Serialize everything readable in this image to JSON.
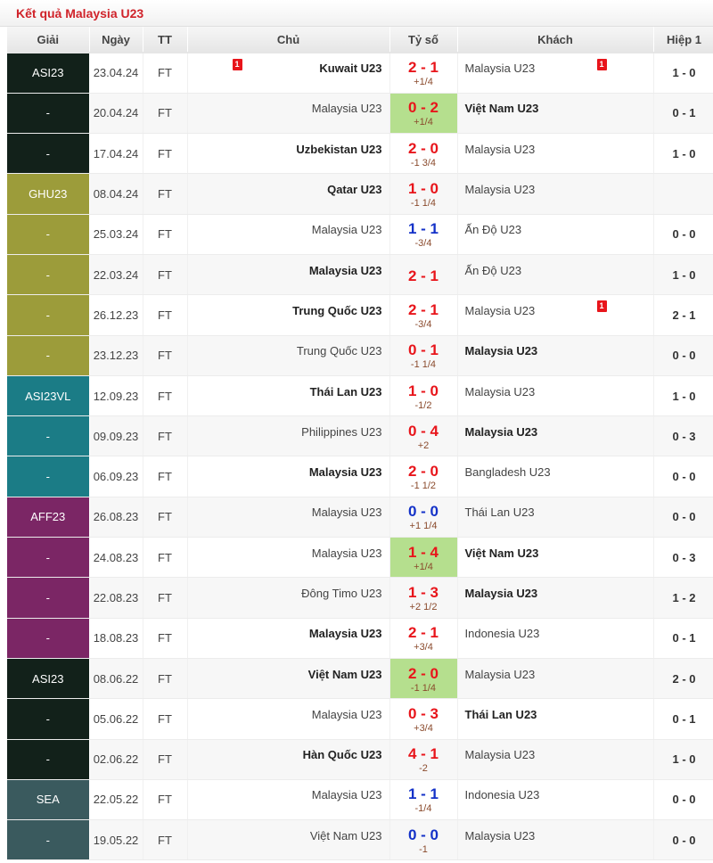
{
  "page": {
    "title": "Kết quả Malaysia U23"
  },
  "columns": {
    "league": "Giải",
    "date": "Ngày",
    "status": "TT",
    "home": "Chủ",
    "score": "Tỷ số",
    "away": "Khách",
    "halftime": "Hiệp 1"
  },
  "colors": {
    "title": "#d0232a",
    "score_red": "#e8151b",
    "score_blue": "#1432c8",
    "handicap": "#8a4a2c",
    "highlight_score": "#b5df8e",
    "card": "#e8151b",
    "league_ASI23": "#12211a",
    "league_GHU23": "#9c9c3a",
    "league_ASI23VL": "#1b7c86",
    "league_AFF23": "#7b2665",
    "league_SEA": "#3a5a5e"
  },
  "matches": [
    {
      "league": "ASI23",
      "date": "23.04.24",
      "status": "FT",
      "home": "Kuwait U23",
      "home_bold": true,
      "home_card": "1",
      "score": "2 - 1",
      "score_color": "red",
      "handicap": "+1/4",
      "score_highlight": false,
      "away": "Malaysia U23",
      "away_bold": false,
      "away_card": "1",
      "ht": "1 - 0",
      "league_color": "#12211a"
    },
    {
      "league": "-",
      "date": "20.04.24",
      "status": "FT",
      "home": "Malaysia U23",
      "home_bold": false,
      "home_card": "",
      "score": "0 - 2",
      "score_color": "red",
      "handicap": "+1/4",
      "score_highlight": true,
      "away": "Việt Nam U23",
      "away_bold": true,
      "away_card": "",
      "ht": "0 - 1",
      "league_color": "#12211a"
    },
    {
      "league": "-",
      "date": "17.04.24",
      "status": "FT",
      "home": "Uzbekistan U23",
      "home_bold": true,
      "home_card": "",
      "score": "2 - 0",
      "score_color": "red",
      "handicap": "-1 3/4",
      "score_highlight": false,
      "away": "Malaysia U23",
      "away_bold": false,
      "away_card": "",
      "ht": "1 - 0",
      "league_color": "#12211a"
    },
    {
      "league": "GHU23",
      "date": "08.04.24",
      "status": "FT",
      "home": "Qatar U23",
      "home_bold": true,
      "home_card": "",
      "score": "1 - 0",
      "score_color": "red",
      "handicap": "-1 1/4",
      "score_highlight": false,
      "away": "Malaysia U23",
      "away_bold": false,
      "away_card": "",
      "ht": "",
      "league_color": "#9c9c3a"
    },
    {
      "league": "-",
      "date": "25.03.24",
      "status": "FT",
      "home": "Malaysia U23",
      "home_bold": false,
      "home_card": "",
      "score": "1 - 1",
      "score_color": "blue",
      "handicap": "-3/4",
      "score_highlight": false,
      "away": "Ấn Độ U23",
      "away_bold": false,
      "away_card": "",
      "ht": "0 - 0",
      "league_color": "#9c9c3a"
    },
    {
      "league": "-",
      "date": "22.03.24",
      "status": "FT",
      "home": "Malaysia U23",
      "home_bold": true,
      "home_card": "",
      "score": "2 - 1",
      "score_color": "red",
      "handicap": "",
      "score_highlight": false,
      "away": "Ấn Độ U23",
      "away_bold": false,
      "away_card": "",
      "ht": "1 - 0",
      "league_color": "#9c9c3a"
    },
    {
      "league": "-",
      "date": "26.12.23",
      "status": "FT",
      "home": "Trung Quốc U23",
      "home_bold": true,
      "home_card": "",
      "score": "2 - 1",
      "score_color": "red",
      "handicap": "-3/4",
      "score_highlight": false,
      "away": "Malaysia U23",
      "away_bold": false,
      "away_card": "1",
      "ht": "2 - 1",
      "league_color": "#9c9c3a"
    },
    {
      "league": "-",
      "date": "23.12.23",
      "status": "FT",
      "home": "Trung Quốc U23",
      "home_bold": false,
      "home_card": "",
      "score": "0 - 1",
      "score_color": "red",
      "handicap": "-1 1/4",
      "score_highlight": false,
      "away": "Malaysia U23",
      "away_bold": true,
      "away_card": "",
      "ht": "0 - 0",
      "league_color": "#9c9c3a"
    },
    {
      "league": "ASI23VL",
      "date": "12.09.23",
      "status": "FT",
      "home": "Thái Lan U23",
      "home_bold": true,
      "home_card": "",
      "score": "1 - 0",
      "score_color": "red",
      "handicap": "-1/2",
      "score_highlight": false,
      "away": "Malaysia U23",
      "away_bold": false,
      "away_card": "",
      "ht": "1 - 0",
      "league_color": "#1b7c86"
    },
    {
      "league": "-",
      "date": "09.09.23",
      "status": "FT",
      "home": "Philippines U23",
      "home_bold": false,
      "home_card": "",
      "score": "0 - 4",
      "score_color": "red",
      "handicap": "+2",
      "score_highlight": false,
      "away": "Malaysia U23",
      "away_bold": true,
      "away_card": "",
      "ht": "0 - 3",
      "league_color": "#1b7c86"
    },
    {
      "league": "-",
      "date": "06.09.23",
      "status": "FT",
      "home": "Malaysia U23",
      "home_bold": true,
      "home_card": "",
      "score": "2 - 0",
      "score_color": "red",
      "handicap": "-1 1/2",
      "score_highlight": false,
      "away": "Bangladesh U23",
      "away_bold": false,
      "away_card": "",
      "ht": "0 - 0",
      "league_color": "#1b7c86"
    },
    {
      "league": "AFF23",
      "date": "26.08.23",
      "status": "FT",
      "home": "Malaysia U23",
      "home_bold": false,
      "home_card": "",
      "score": "0 - 0",
      "score_color": "blue",
      "handicap": "+1 1/4",
      "score_highlight": false,
      "away": "Thái Lan U23",
      "away_bold": false,
      "away_card": "",
      "ht": "0 - 0",
      "league_color": "#7b2665"
    },
    {
      "league": "-",
      "date": "24.08.23",
      "status": "FT",
      "home": "Malaysia U23",
      "home_bold": false,
      "home_card": "",
      "score": "1 - 4",
      "score_color": "red",
      "handicap": "+1/4",
      "score_highlight": true,
      "away": "Việt Nam U23",
      "away_bold": true,
      "away_card": "",
      "ht": "0 - 3",
      "league_color": "#7b2665"
    },
    {
      "league": "-",
      "date": "22.08.23",
      "status": "FT",
      "home": "Đông Timo U23",
      "home_bold": false,
      "home_card": "",
      "score": "1 - 3",
      "score_color": "red",
      "handicap": "+2 1/2",
      "score_highlight": false,
      "away": "Malaysia U23",
      "away_bold": true,
      "away_card": "",
      "ht": "1 - 2",
      "league_color": "#7b2665"
    },
    {
      "league": "-",
      "date": "18.08.23",
      "status": "FT",
      "home": "Malaysia U23",
      "home_bold": true,
      "home_card": "",
      "score": "2 - 1",
      "score_color": "red",
      "handicap": "+3/4",
      "score_highlight": false,
      "away": "Indonesia U23",
      "away_bold": false,
      "away_card": "",
      "ht": "0 - 1",
      "league_color": "#7b2665"
    },
    {
      "league": "ASI23",
      "date": "08.06.22",
      "status": "FT",
      "home": "Việt Nam U23",
      "home_bold": true,
      "home_card": "",
      "score": "2 - 0",
      "score_color": "red",
      "handicap": "-1 1/4",
      "score_highlight": true,
      "away": "Malaysia U23",
      "away_bold": false,
      "away_card": "",
      "ht": "2 - 0",
      "league_color": "#12211a"
    },
    {
      "league": "-",
      "date": "05.06.22",
      "status": "FT",
      "home": "Malaysia U23",
      "home_bold": false,
      "home_card": "",
      "score": "0 - 3",
      "score_color": "red",
      "handicap": "+3/4",
      "score_highlight": false,
      "away": "Thái Lan U23",
      "away_bold": true,
      "away_card": "",
      "ht": "0 - 1",
      "league_color": "#12211a"
    },
    {
      "league": "-",
      "date": "02.06.22",
      "status": "FT",
      "home": "Hàn Quốc U23",
      "home_bold": true,
      "home_card": "",
      "score": "4 - 1",
      "score_color": "red",
      "handicap": "-2",
      "score_highlight": false,
      "away": "Malaysia U23",
      "away_bold": false,
      "away_card": "",
      "ht": "1 - 0",
      "league_color": "#12211a"
    },
    {
      "league": "SEA",
      "date": "22.05.22",
      "status": "FT",
      "home": "Malaysia U23",
      "home_bold": false,
      "home_card": "",
      "score": "1 - 1",
      "score_color": "blue",
      "handicap": "-1/4",
      "score_highlight": false,
      "away": "Indonesia U23",
      "away_bold": false,
      "away_card": "",
      "ht": "0 - 0",
      "league_color": "#3a5a5e"
    },
    {
      "league": "-",
      "date": "19.05.22",
      "status": "FT",
      "home": "Việt Nam U23",
      "home_bold": false,
      "home_card": "",
      "score": "0 - 0",
      "score_color": "blue",
      "handicap": "-1",
      "score_highlight": false,
      "away": "Malaysia U23",
      "away_bold": false,
      "away_card": "",
      "ht": "0 - 0",
      "league_color": "#3a5a5e"
    }
  ]
}
